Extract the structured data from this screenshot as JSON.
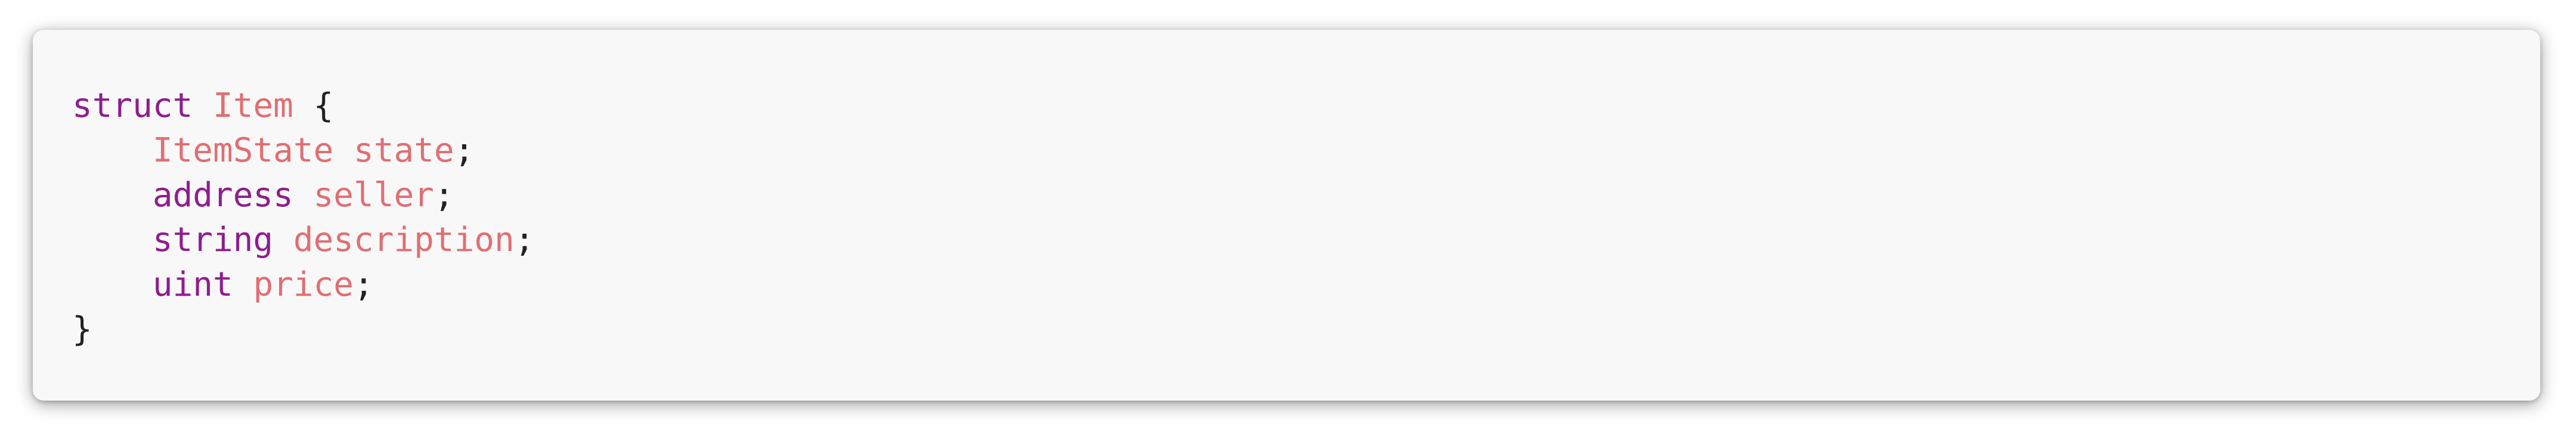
{
  "colors": {
    "keyword": "#8e1e8e",
    "identifier": "#df6f73",
    "punctuation": "#222222",
    "background": "#f8f8f8"
  },
  "code": {
    "indent": "    ",
    "line1": {
      "keyword": "struct",
      "name": "Item",
      "open": "{"
    },
    "line2": {
      "type": "ItemState",
      "name": "state",
      "end": ";"
    },
    "line3": {
      "type": "address",
      "name": "seller",
      "end": ";"
    },
    "line4": {
      "type": "string",
      "name": "description",
      "end": ";"
    },
    "line5": {
      "type": "uint",
      "name": "price",
      "end": ";"
    },
    "line6": {
      "close": "}"
    }
  }
}
